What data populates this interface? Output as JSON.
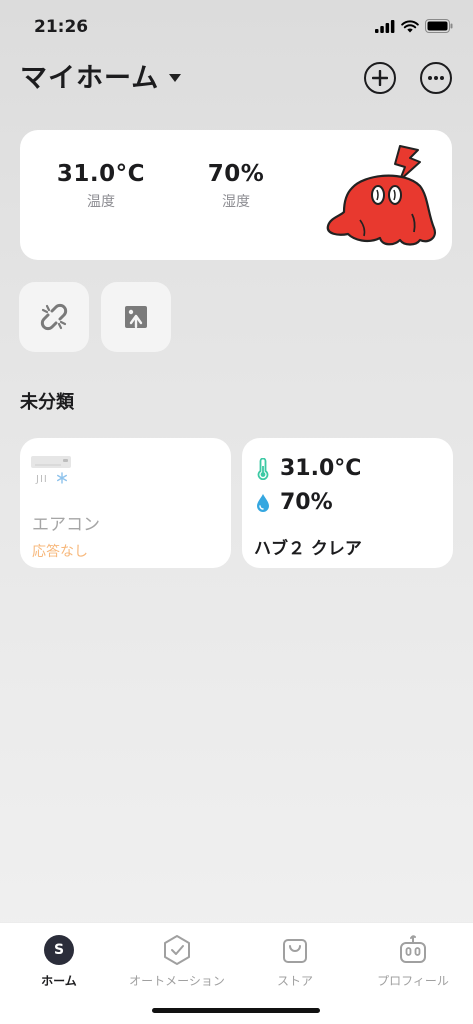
{
  "status_bar": {
    "time": "21:26"
  },
  "header": {
    "title": "マイホーム"
  },
  "summary": {
    "temperature": {
      "value": "31.0°C",
      "label": "温度"
    },
    "humidity": {
      "value": "70%",
      "label": "湿度"
    }
  },
  "section": {
    "title": "未分類"
  },
  "devices": [
    {
      "name": "エアコン",
      "status": "応答なし",
      "mode_label": "JII"
    },
    {
      "name": "ハブ２ クレア",
      "temperature": "31.0°C",
      "humidity": "70%"
    }
  ],
  "tabs": [
    {
      "label": "ホーム",
      "avatar_letter": "S",
      "active": true
    },
    {
      "label": "オートメーション"
    },
    {
      "label": "ストア"
    },
    {
      "label": "プロフィール"
    }
  ],
  "colors": {
    "mascot_red": "#e8392f",
    "offline_orange": "#f7b87c",
    "thermo_green": "#3cc9a4",
    "humidity_blue": "#35a7e0"
  }
}
